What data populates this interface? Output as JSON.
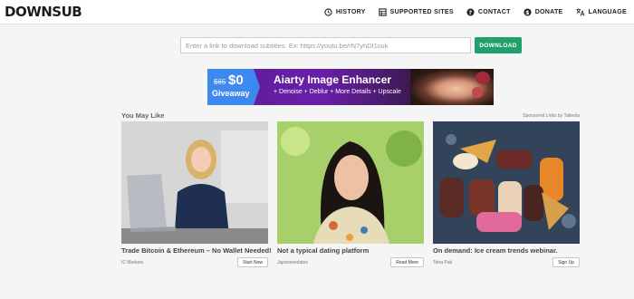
{
  "header": {
    "logo": "DOWNSUB",
    "nav": [
      {
        "label": "HISTORY",
        "icon": "history-icon"
      },
      {
        "label": "SUPPORTED SITES",
        "icon": "grid-icon"
      },
      {
        "label": "CONTACT",
        "icon": "question-icon"
      },
      {
        "label": "DONATE",
        "icon": "dollar-icon"
      },
      {
        "label": "LANGUAGE",
        "icon": "translate-icon"
      }
    ]
  },
  "search": {
    "placeholder": "Enter a link to download subtitles. Ex: https://youtu.be/rN7yhDI1cuk",
    "value": "",
    "button_label": "DOWNLOAD"
  },
  "banner": {
    "old_price": "$65",
    "price": "$0",
    "giveaway": "Giveaway",
    "title": "Aiarty Image Enhancer",
    "features": "+ Denoise  + Deblur  + More Details  + Upscale"
  },
  "recommend": {
    "heading": "You May Like",
    "sponsored": "Sponsored Links by Taboola",
    "cards": [
      {
        "title": "Trade Bitcoin & Ethereum – No Wallet Needed!",
        "source": "IC Markets",
        "button": "Start Now"
      },
      {
        "title": "Not a typical dating platform",
        "source": "Japanesedates",
        "button": "Read More"
      },
      {
        "title": "On demand: Ice cream trends webinar.",
        "source": "Tetra Pak",
        "button": "Sign Up"
      }
    ]
  },
  "colors": {
    "accent": "#22a06b",
    "banner_blue": "#3e89f0",
    "banner_purple": "#6a1fa8"
  }
}
